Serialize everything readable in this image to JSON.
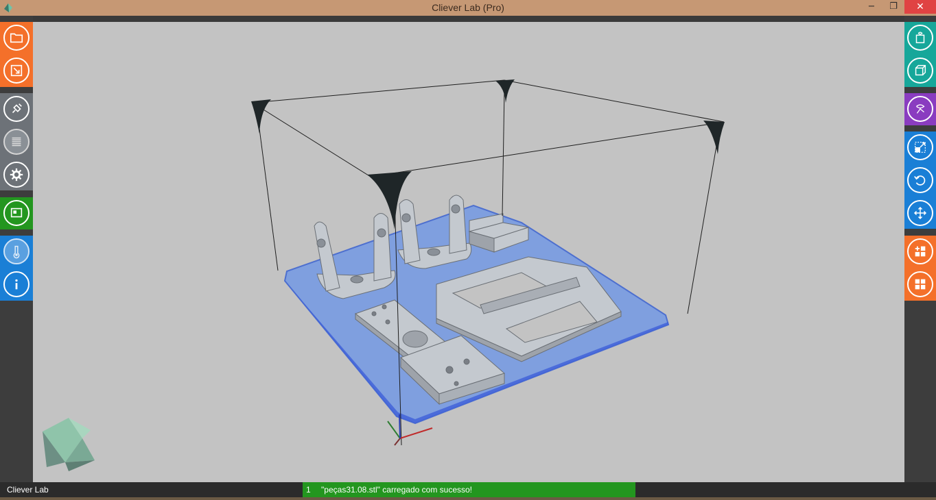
{
  "window": {
    "title": "Cliever Lab (Pro)",
    "controls": {
      "minimize": "−",
      "maximize": "❐",
      "close": "✕"
    }
  },
  "left_toolbar": {
    "groups": [
      {
        "color": "#f4702a",
        "buttons": [
          {
            "name": "open-file-button",
            "icon": "folder-icon"
          },
          {
            "name": "export-button",
            "icon": "export-icon"
          }
        ]
      },
      {
        "color": "#6d7278",
        "buttons": [
          {
            "name": "connect-button",
            "icon": "plug-icon"
          },
          {
            "name": "slice-button",
            "icon": "layers-icon"
          },
          {
            "name": "settings-button",
            "icon": "gear-icon"
          }
        ]
      },
      {
        "color": "#23961f",
        "buttons": [
          {
            "name": "print-panel-button",
            "icon": "screen-icon"
          }
        ]
      },
      {
        "color": "#1a7fd6",
        "buttons": [
          {
            "name": "temperature-button",
            "icon": "thermometer-icon"
          },
          {
            "name": "info-button",
            "icon": "info-icon"
          }
        ]
      }
    ]
  },
  "right_toolbar": {
    "groups": [
      {
        "color": "#16a79a",
        "buttons": [
          {
            "name": "view-3d-button",
            "icon": "cube-eye-icon"
          },
          {
            "name": "view-front-button",
            "icon": "cube-icon"
          }
        ]
      },
      {
        "color": "#8a3cc0",
        "buttons": [
          {
            "name": "view-rotate-button",
            "icon": "eye-axes-icon"
          }
        ]
      },
      {
        "color": "#1a7fd6",
        "buttons": [
          {
            "name": "scale-button",
            "icon": "scale-icon"
          },
          {
            "name": "rotate-button",
            "icon": "rotate-icon"
          },
          {
            "name": "move-button",
            "icon": "move-icon"
          }
        ]
      },
      {
        "color": "#f4702a",
        "buttons": [
          {
            "name": "add-copies-button",
            "icon": "grid-add-icon"
          },
          {
            "name": "arrange-button",
            "icon": "grid-arrange-icon"
          }
        ]
      }
    ]
  },
  "status": {
    "app_label": "Cliever Lab",
    "message_number": "1",
    "message": "\"peças31.08.stl\" carregado com sucesso!"
  },
  "colors": {
    "viewport_bg": "#c3c3c3",
    "build_plate": "#7f9fdf",
    "model": "#c4c9cf",
    "success": "#23961f"
  }
}
